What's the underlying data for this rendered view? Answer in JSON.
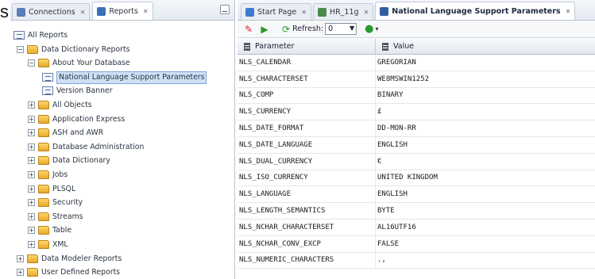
{
  "corner_glyph": "s",
  "left_panel": {
    "tabs": [
      {
        "label": "Connections",
        "color": "#5a7fb8"
      },
      {
        "label": "Reports",
        "color": "#3b6fb5",
        "active": true
      }
    ],
    "tree": [
      {
        "label": "All Reports",
        "level": 0,
        "expander": "",
        "icon": "report"
      },
      {
        "label": "Data Dictionary Reports",
        "level": 1,
        "expander": "−",
        "icon": "folder"
      },
      {
        "label": "About Your Database",
        "level": 2,
        "expander": "−",
        "icon": "folder"
      },
      {
        "label": "National Language Support Parameters",
        "level": 3,
        "expander": "",
        "icon": "report",
        "selected": true
      },
      {
        "label": "Version Banner",
        "level": 3,
        "expander": "",
        "icon": "report"
      },
      {
        "label": "All Objects",
        "level": 2,
        "expander": "+",
        "icon": "folder"
      },
      {
        "label": "Application Express",
        "level": 2,
        "expander": "+",
        "icon": "folder"
      },
      {
        "label": "ASH and AWR",
        "level": 2,
        "expander": "+",
        "icon": "folder"
      },
      {
        "label": "Database Administration",
        "level": 2,
        "expander": "+",
        "icon": "folder"
      },
      {
        "label": "Data Dictionary",
        "level": 2,
        "expander": "+",
        "icon": "folder"
      },
      {
        "label": "Jobs",
        "level": 2,
        "expander": "+",
        "icon": "folder"
      },
      {
        "label": "PLSQL",
        "level": 2,
        "expander": "+",
        "icon": "folder"
      },
      {
        "label": "Security",
        "level": 2,
        "expander": "+",
        "icon": "folder"
      },
      {
        "label": "Streams",
        "level": 2,
        "expander": "+",
        "icon": "folder"
      },
      {
        "label": "Table",
        "level": 2,
        "expander": "+",
        "icon": "folder"
      },
      {
        "label": "XML",
        "level": 2,
        "expander": "+",
        "icon": "folder"
      },
      {
        "label": "Data Modeler Reports",
        "level": 1,
        "expander": "+",
        "icon": "folder"
      },
      {
        "label": "User Defined Reports",
        "level": 1,
        "expander": "+",
        "icon": "folder"
      }
    ]
  },
  "editor": {
    "tabs": [
      {
        "label": "Start Page",
        "color": "#3b7bd0"
      },
      {
        "label": "HR_11g",
        "color": "#4a8a4a"
      },
      {
        "label": "National Language Support Parameters",
        "color": "#2f5f9f",
        "active": true
      }
    ],
    "toolbar": {
      "refresh_label": "Refresh:",
      "refresh_value": "0"
    },
    "columns": [
      "Parameter",
      "Value"
    ],
    "rows": [
      [
        "NLS_CALENDAR",
        "GREGORIAN"
      ],
      [
        "NLS_CHARACTERSET",
        "WE8MSWIN1252"
      ],
      [
        "NLS_COMP",
        "BINARY"
      ],
      [
        "NLS_CURRENCY",
        "£"
      ],
      [
        "NLS_DATE_FORMAT",
        "DD-MON-RR"
      ],
      [
        "NLS_DATE_LANGUAGE",
        "ENGLISH"
      ],
      [
        "NLS_DUAL_CURRENCY",
        "€"
      ],
      [
        "NLS_ISO_CURRENCY",
        "UNITED KINGDOM"
      ],
      [
        "NLS_LANGUAGE",
        "ENGLISH"
      ],
      [
        "NLS_LENGTH_SEMANTICS",
        "BYTE"
      ],
      [
        "NLS_NCHAR_CHARACTERSET",
        "AL16UTF16"
      ],
      [
        "NLS_NCHAR_CONV_EXCP",
        "FALSE"
      ],
      [
        "NLS_NUMERIC_CHARACTERS",
        ".,"
      ]
    ]
  }
}
